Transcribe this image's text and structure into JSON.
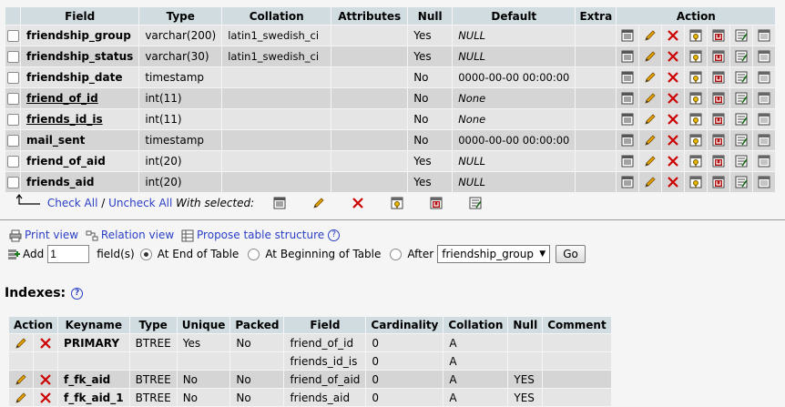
{
  "columns_header": {
    "field": "Field",
    "type": "Type",
    "collation": "Collation",
    "attributes": "Attributes",
    "null": "Null",
    "default": "Default",
    "extra": "Extra",
    "action": "Action"
  },
  "rows": [
    {
      "field": "friendship_group",
      "type": "varchar(200)",
      "collation": "latin1_swedish_ci",
      "attributes": "",
      "null": "Yes",
      "default": "NULL",
      "extra": ""
    },
    {
      "field": "friendship_status",
      "type": "varchar(30)",
      "collation": "latin1_swedish_ci",
      "attributes": "",
      "null": "Yes",
      "default": "NULL",
      "extra": ""
    },
    {
      "field": "friendship_date",
      "type": "timestamp",
      "collation": "",
      "attributes": "",
      "null": "No",
      "default": "0000-00-00 00:00:00",
      "extra": ""
    },
    {
      "field": "friend_of_id",
      "type": "int(11)",
      "collation": "",
      "attributes": "",
      "null": "No",
      "default": "None",
      "extra": ""
    },
    {
      "field": "friends_id_is",
      "type": "int(11)",
      "collation": "",
      "attributes": "",
      "null": "No",
      "default": "None",
      "extra": ""
    },
    {
      "field": "mail_sent",
      "type": "timestamp",
      "collation": "",
      "attributes": "",
      "null": "No",
      "default": "0000-00-00 00:00:00",
      "extra": ""
    },
    {
      "field": "friend_of_aid",
      "type": "int(20)",
      "collation": "",
      "attributes": "",
      "null": "Yes",
      "default": "NULL",
      "extra": ""
    },
    {
      "field": "friends_aid",
      "type": "int(20)",
      "collation": "",
      "attributes": "",
      "null": "Yes",
      "default": "NULL",
      "extra": ""
    }
  ],
  "with_selected": {
    "check_all": "Check All",
    "separator": " / ",
    "uncheck_all": "Uncheck All",
    "label": "With selected:"
  },
  "links": {
    "print_view": "Print view",
    "relation_view": "Relation view",
    "propose": "Propose table structure"
  },
  "add_fields": {
    "add_label": "Add",
    "count_value": "1",
    "fields_label": "field(s)",
    "end_of_table": "At End of Table",
    "beginning_of_table": "At Beginning of Table",
    "after": "After",
    "after_selected": "friendship_group",
    "go": "Go"
  },
  "indexes": {
    "title": "Indexes:",
    "help": "?",
    "header": {
      "action": "Action",
      "keyname": "Keyname",
      "type": "Type",
      "unique": "Unique",
      "packed": "Packed",
      "field": "Field",
      "cardinality": "Cardinality",
      "collation": "Collation",
      "null": "Null",
      "comment": "Comment"
    },
    "rows": [
      {
        "keyname": "PRIMARY",
        "type": "BTREE",
        "unique": "Yes",
        "packed": "No",
        "field": "friend_of_id",
        "cardinality": "0",
        "collation": "A",
        "null": "",
        "comment": ""
      },
      {
        "keyname": "",
        "type": "",
        "unique": "",
        "packed": "",
        "field": "friends_id_is",
        "cardinality": "0",
        "collation": "A",
        "null": "",
        "comment": ""
      },
      {
        "keyname": "f_fk_aid",
        "type": "BTREE",
        "unique": "No",
        "packed": "No",
        "field": "friend_of_aid",
        "cardinality": "0",
        "collation": "A",
        "null": "YES",
        "comment": ""
      },
      {
        "keyname": "f_fk_aid_1",
        "type": "BTREE",
        "unique": "No",
        "packed": "No",
        "field": "friends_aid",
        "cardinality": "0",
        "collation": "A",
        "null": "YES",
        "comment": ""
      }
    ]
  },
  "action_icons": [
    "browse-icon",
    "edit-pencil-icon",
    "delete-x-icon",
    "primary-key-icon",
    "unique-icon",
    "index-icon",
    "fulltext-icon"
  ],
  "colors": {
    "header_bg": "#d0dce0",
    "row_odd": "#e5e5e5",
    "row_even": "#d5d5d5",
    "link": "#2a3fc5",
    "delete_red": "#cc0000"
  }
}
